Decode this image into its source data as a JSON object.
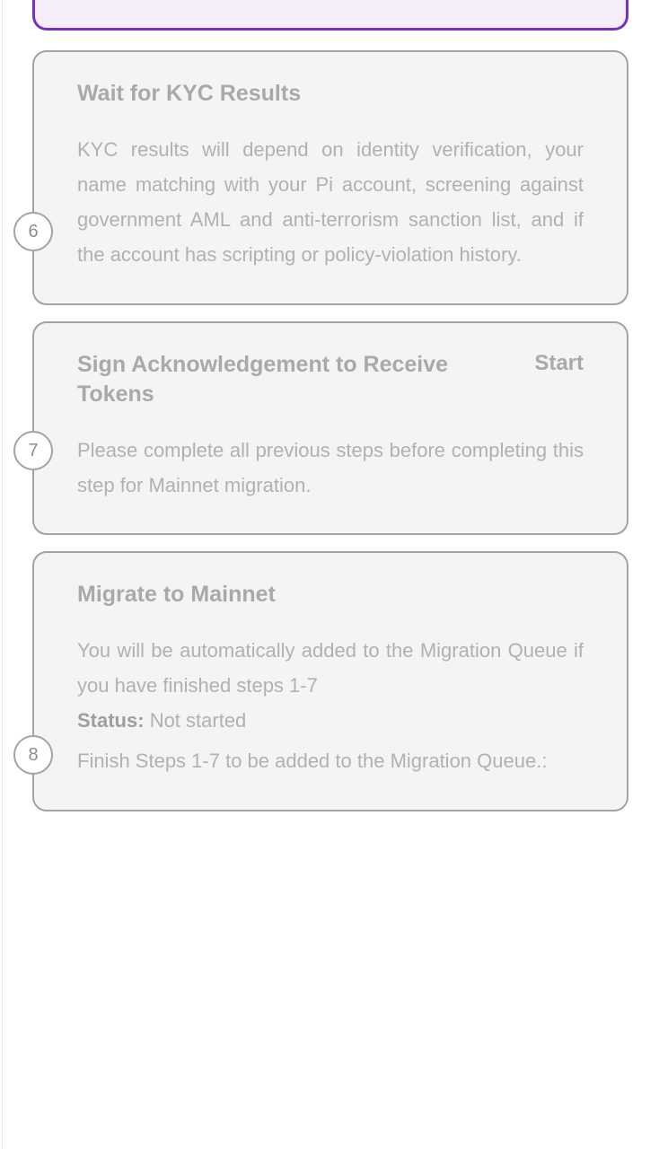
{
  "theme": {
    "page_background": "#ffffff",
    "card_background": "#f4f4f4",
    "card_border": "#a3a3a3",
    "accent_purple_border": "#7b2fbe",
    "accent_purple_fill": "#f5edfa",
    "heading_text": "#a9a9a9",
    "body_text": "#b1b1b1",
    "badge_text": "#8e8e8e"
  },
  "steps": [
    {
      "id": "partial-top",
      "number": "",
      "title": "",
      "action_label": "",
      "highlighted": true,
      "paragraphs": []
    },
    {
      "id": "wait-for-kyc-results",
      "number": "6",
      "title": "Wait for KYC Results",
      "action_label": "",
      "highlighted": false,
      "paragraphs": [
        "KYC results will depend on identity verification, your name matching with your Pi account, screening against government AML and anti-terrorism sanction list, and if the account has scripting or policy-violation history."
      ]
    },
    {
      "id": "sign-acknowledgement",
      "number": "7",
      "title": "Sign Acknowledgement to Receive Tokens",
      "action_label": "Start",
      "highlighted": false,
      "paragraphs": [
        "Please complete all previous steps before completing this step for Mainnet migration."
      ]
    },
    {
      "id": "migrate-to-mainnet",
      "number": "8",
      "title": "Migrate to Mainnet",
      "action_label": "",
      "highlighted": false,
      "paragraphs": [
        "You will be automatically added to the Migration Queue if you have finished steps 1-7"
      ],
      "status": {
        "label": "Status:",
        "value": "Not started",
        "detail": "Finish Steps 1-7 to be added to the Migration Queue.:"
      }
    }
  ]
}
